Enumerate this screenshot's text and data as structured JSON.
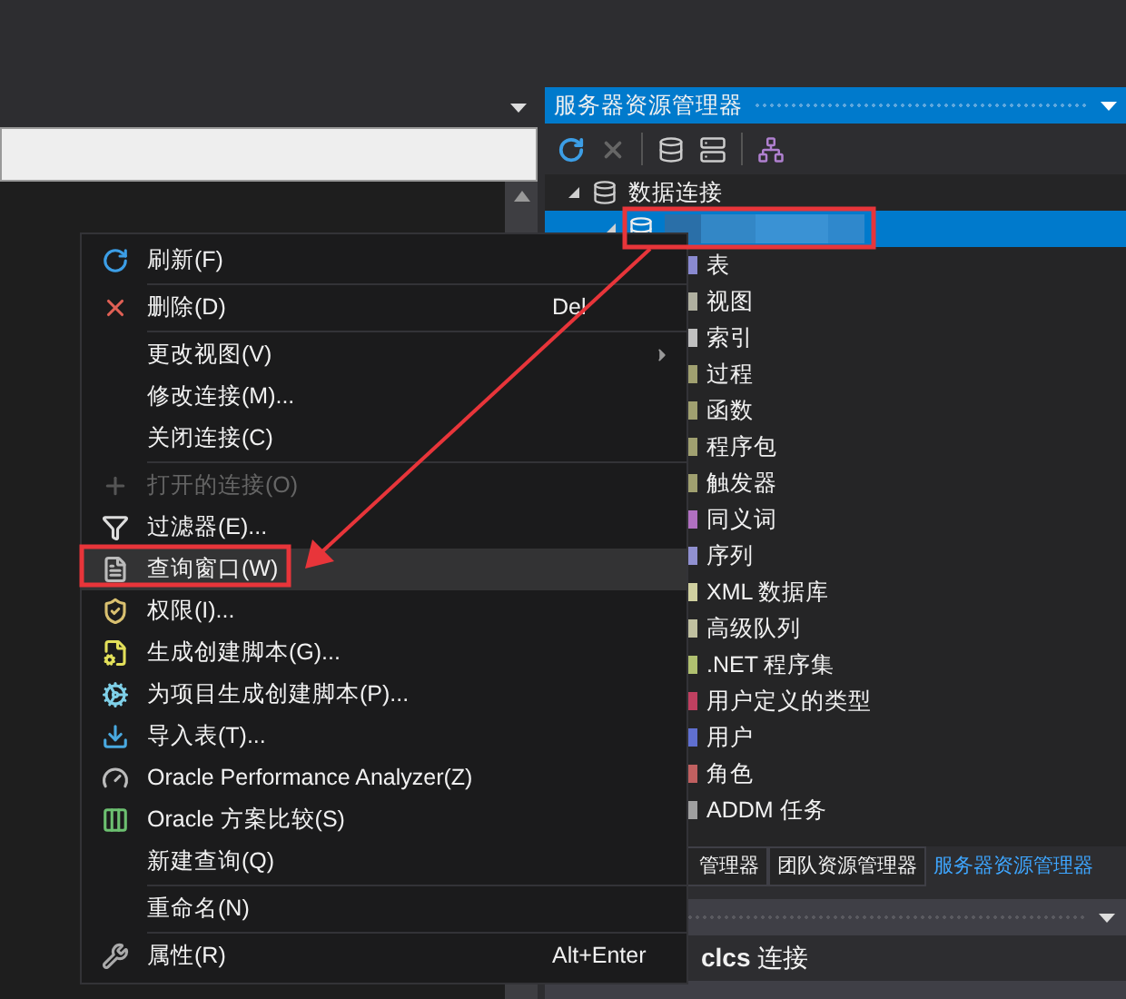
{
  "explorer": {
    "title": "服务器资源管理器"
  },
  "tree": [
    {
      "label": "数据连接",
      "expanded": true,
      "children": [
        {
          "kind": "redacted",
          "selected": true,
          "expanded": true,
          "children": [
            {
              "label": "表"
            },
            {
              "label": "视图"
            },
            {
              "label": "索引"
            },
            {
              "label": "过程"
            },
            {
              "label": "函数"
            },
            {
              "label": "程序包"
            },
            {
              "label": "触发器"
            },
            {
              "label": "同义词"
            },
            {
              "label": "序列"
            },
            {
              "label": "XML 数据库"
            },
            {
              "label": "高级队列"
            },
            {
              "label": ".NET 程序集"
            },
            {
              "label": "用户定义的类型"
            },
            {
              "label": "用户"
            },
            {
              "label": "角色"
            },
            {
              "label": "ADDM 任务"
            }
          ]
        }
      ]
    }
  ],
  "tabs": [
    {
      "label": "管理器",
      "selected": false
    },
    {
      "label": "团队资源管理器",
      "selected": false
    },
    {
      "label": "服务器资源管理器",
      "selected": true
    }
  ],
  "lower_panel": {
    "item": "**clcs** 连接"
  },
  "context_menu": {
    "items": [
      {
        "kind": "item",
        "label": "刷新(F)",
        "disabled": false,
        "selected": false
      },
      {
        "kind": "separator"
      },
      {
        "kind": "item",
        "label": "删除(D)",
        "shortcut": "Del",
        "disabled": false,
        "selected": false
      },
      {
        "kind": "separator"
      },
      {
        "kind": "item",
        "label": "更改视图(V)",
        "submenu": true,
        "disabled": false,
        "selected": false
      },
      {
        "kind": "item",
        "label": "修改连接(M)...",
        "disabled": false,
        "selected": false
      },
      {
        "kind": "item",
        "label": "关闭连接(C)",
        "disabled": false,
        "selected": false
      },
      {
        "kind": "separator"
      },
      {
        "kind": "item",
        "label": "打开的连接(O)",
        "disabled": true,
        "selected": false
      },
      {
        "kind": "item",
        "label": "过滤器(E)...",
        "disabled": false,
        "selected": false
      },
      {
        "kind": "item",
        "label": "查询窗口(W)",
        "disabled": false,
        "selected": true
      },
      {
        "kind": "item",
        "label": "权限(I)...",
        "disabled": false,
        "selected": false
      },
      {
        "kind": "item",
        "label": "生成创建脚本(G)...",
        "disabled": false,
        "selected": false
      },
      {
        "kind": "item",
        "label": "为项目生成创建脚本(P)...",
        "disabled": false,
        "selected": false
      },
      {
        "kind": "item",
        "label": "导入表(T)...",
        "disabled": false,
        "selected": false
      },
      {
        "kind": "item",
        "label": "Oracle Performance Analyzer(Z)",
        "disabled": false,
        "selected": false
      },
      {
        "kind": "item",
        "label": "Oracle 方案比较(S)",
        "disabled": false,
        "selected": false
      },
      {
        "kind": "item",
        "label": "新建查询(Q)",
        "disabled": false,
        "selected": false
      },
      {
        "kind": "separator"
      },
      {
        "kind": "item",
        "label": "重命名(N)",
        "disabled": false,
        "selected": false
      },
      {
        "kind": "separator"
      },
      {
        "kind": "item",
        "label": "属性(R)",
        "shortcut": "Alt+Enter",
        "disabled": false,
        "selected": false
      }
    ]
  }
}
